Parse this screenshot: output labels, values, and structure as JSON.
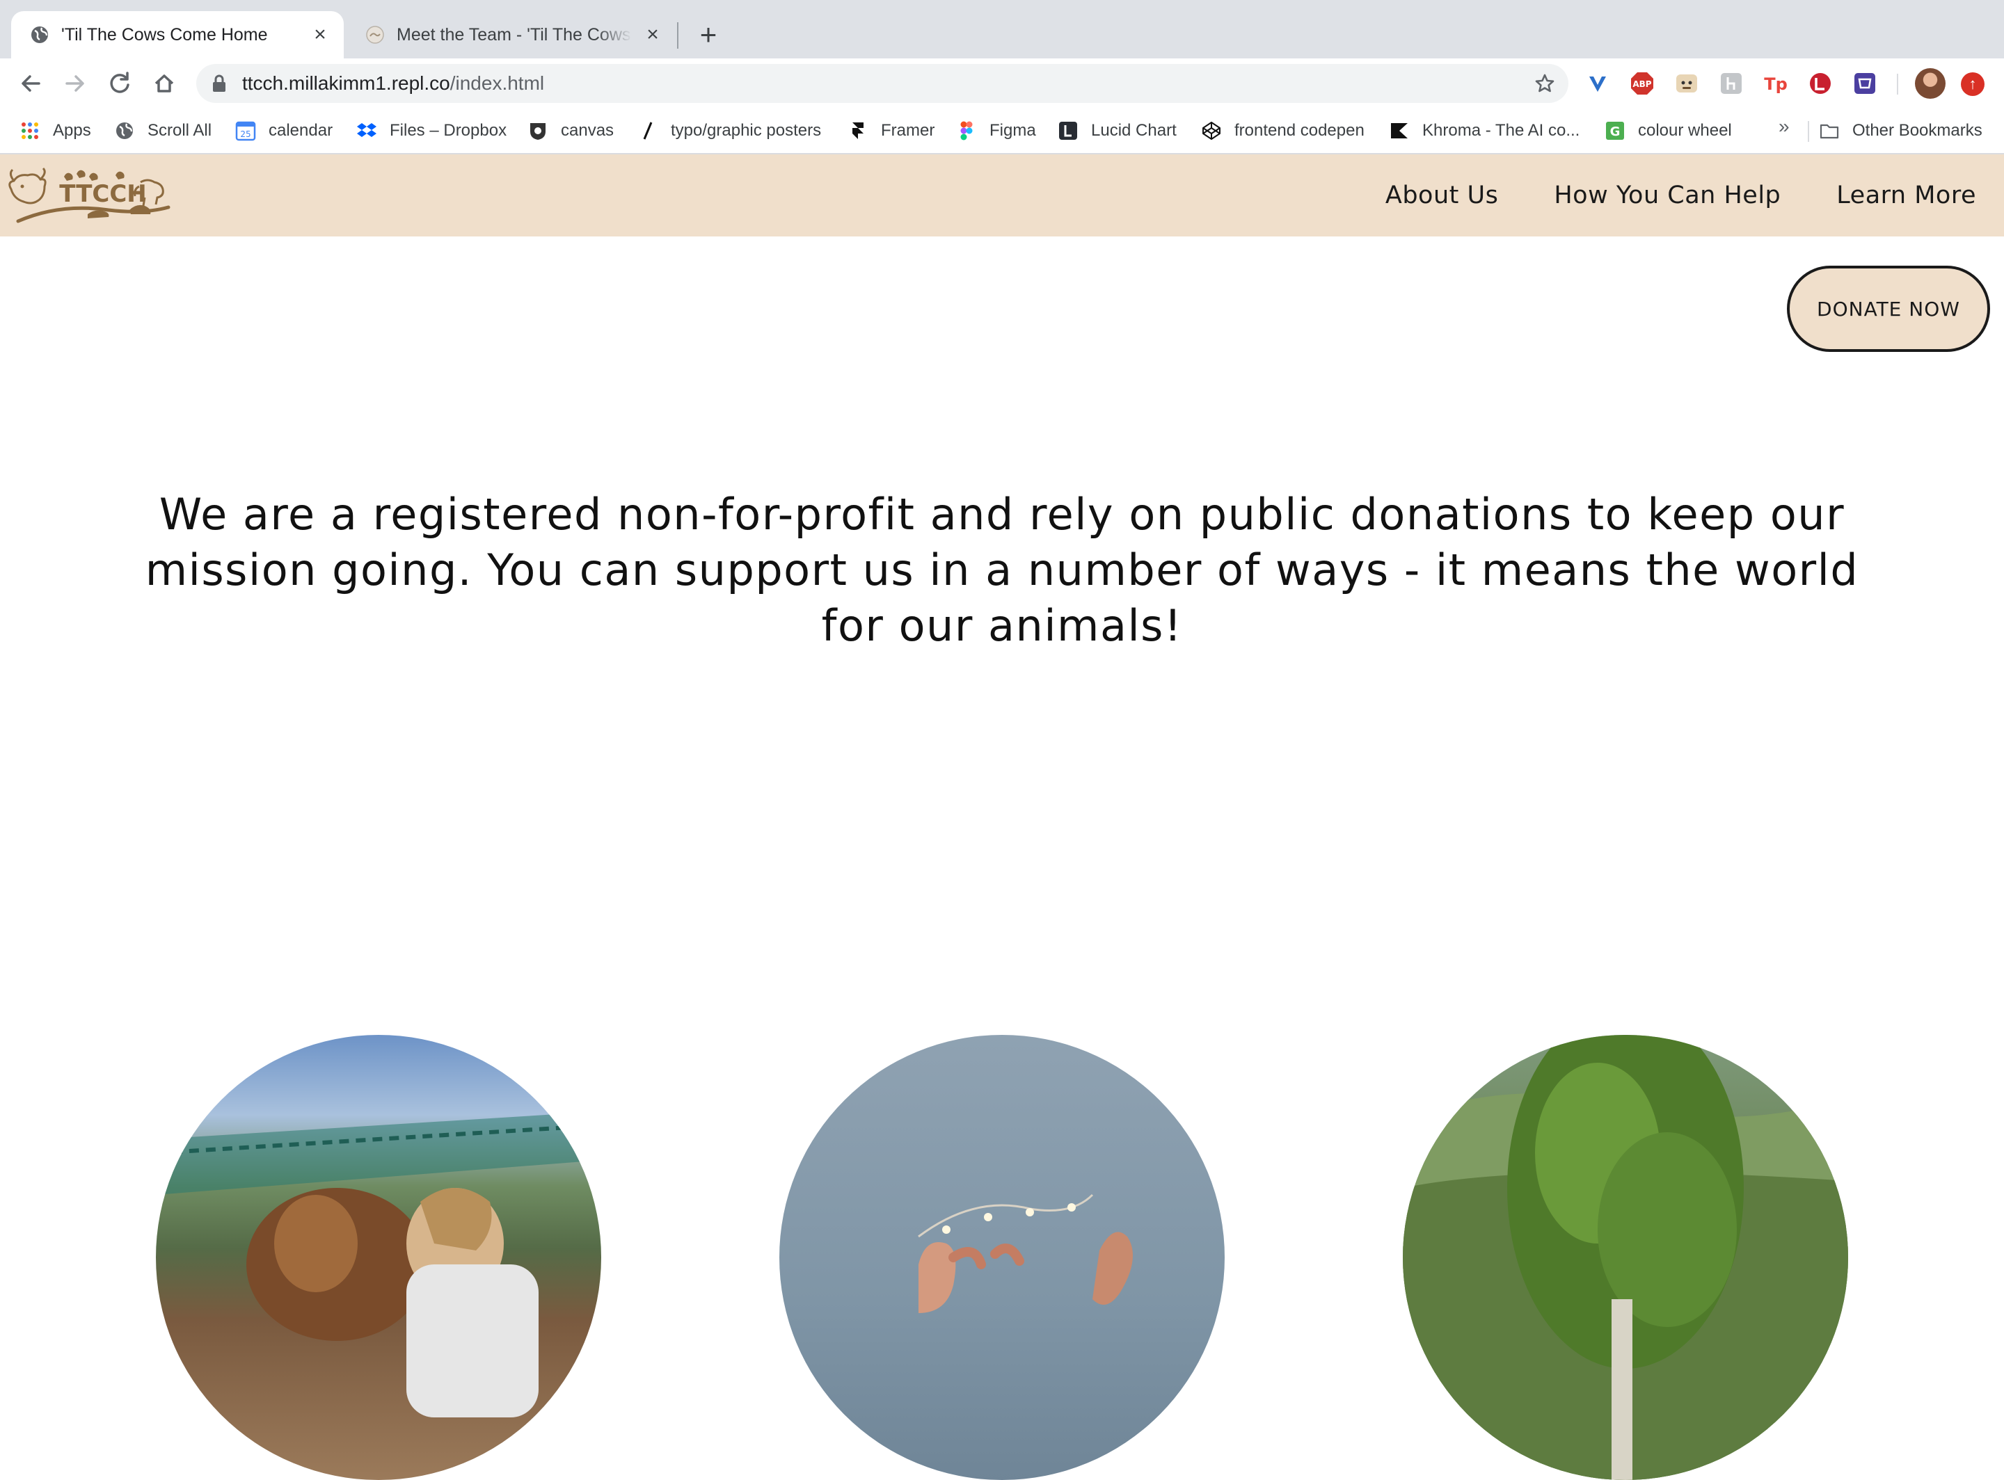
{
  "browser": {
    "tabs": [
      {
        "title": "'Til The Cows Come Home",
        "active": true,
        "favicon": "globe-icon"
      },
      {
        "title": "Meet the Team - 'Til The Cows C",
        "active": false,
        "favicon": "site-favicon-icon"
      }
    ],
    "url_host": "ttcch.millakimm1.repl.co",
    "url_path": "/index.html",
    "extensions": [
      "vimium-icon",
      "adblock-icon",
      "extension-face-icon",
      "extension-gray-icon",
      "tp-icon",
      "lastpass-icon",
      "shopping-icon"
    ],
    "bookmarks": [
      {
        "label": "Apps",
        "icon": "apps-grid-icon"
      },
      {
        "label": "Scroll All",
        "icon": "globe-icon"
      },
      {
        "label": "calendar",
        "icon": "calendar-icon"
      },
      {
        "label": "Files – Dropbox",
        "icon": "dropbox-icon"
      },
      {
        "label": "canvas",
        "icon": "canvas-icon"
      },
      {
        "label": "typo/graphic posters",
        "icon": "slash-icon"
      },
      {
        "label": "Framer",
        "icon": "framer-icon"
      },
      {
        "label": "Figma",
        "icon": "figma-icon"
      },
      {
        "label": "Lucid Chart",
        "icon": "lucid-icon"
      },
      {
        "label": "frontend codepen",
        "icon": "codepen-icon"
      },
      {
        "label": "Khroma - The AI co...",
        "icon": "khroma-icon"
      },
      {
        "label": "colour wheel",
        "icon": "g-icon"
      }
    ],
    "bookmarks_overflow": "»",
    "other_bookmarks": "Other Bookmarks"
  },
  "site": {
    "logo_text": "TTCCH",
    "nav": [
      "About Us",
      "How You Can Help",
      "Learn More"
    ],
    "donate_label": "DONATE NOW",
    "mission_text": "We are a registered non-for-profit and rely on public donations to keep our mission going. You can support us in a number of ways - it means the world for our animals!"
  },
  "colors": {
    "header_bg": "#f0dfcb",
    "logo_brown": "#8c6a3f"
  }
}
